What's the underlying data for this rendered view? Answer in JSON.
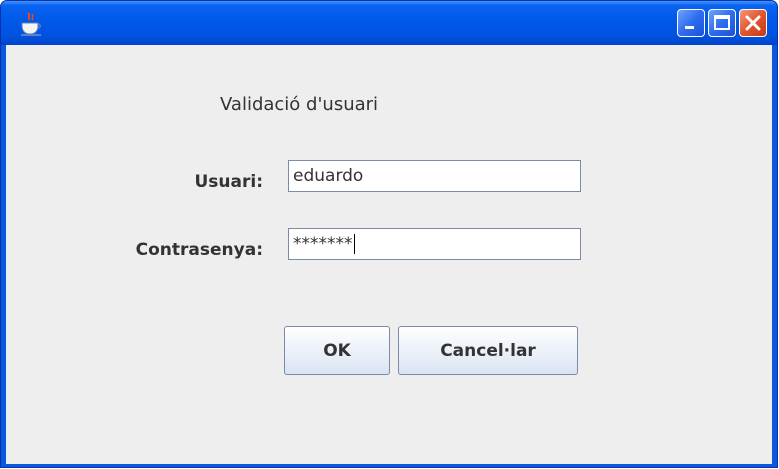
{
  "dialog": {
    "heading": "Validació d'usuari",
    "user_label": "Usuari:",
    "user_value": "eduardo",
    "password_label": "Contrasenya:",
    "password_value": "*******",
    "ok_label": "OK",
    "cancel_label": "Cancel·lar"
  },
  "titlebar": {
    "icon": "java-coffee-cup-icon",
    "controls": [
      "minimize-icon",
      "maximize-icon",
      "close-icon"
    ]
  },
  "colors": {
    "titlebar": "#0058e8",
    "close_button": "#e2552c",
    "content_background": "#eeeeee"
  }
}
